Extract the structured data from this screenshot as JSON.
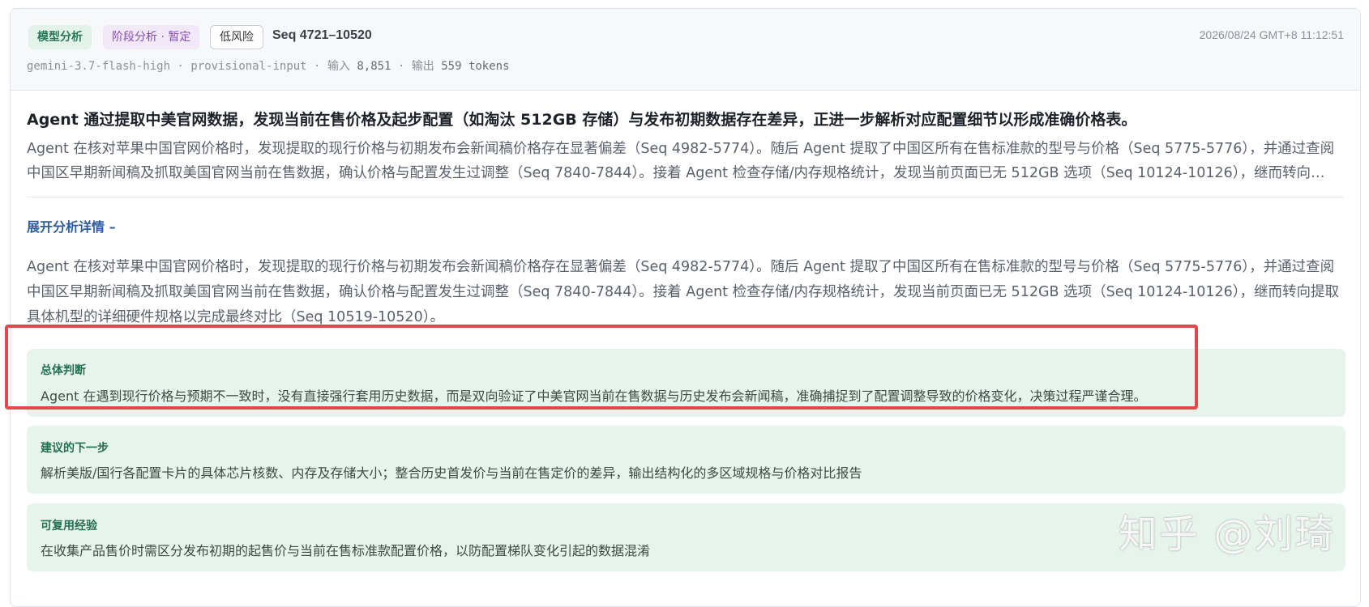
{
  "header": {
    "tags": [
      "模型分析",
      "阶段分析 · 暂定",
      "低风险"
    ],
    "seq": "Seq 4721–10520",
    "timestamp": "2026/08/24 GMT+8 11:12:51",
    "meta": {
      "model": "gemini-3.7-flash-high",
      "mode": "provisional-input",
      "input_label": "输入",
      "input_value": "8,851",
      "output_label": "输出",
      "output_value": "559 tokens"
    }
  },
  "main": {
    "headline": "Agent 通过提取中美官网数据，发现当前在售价格及起步配置（如淘汰 512GB 存储）与发布初期数据存在差异，正进一步解析对应配置细节以形成准确价格表。",
    "summary": "Agent 在核对苹果中国官网价格时，发现提取的现行价格与初期发布会新闻稿价格存在显著偏差（Seq 4982-5774）。随后 Agent 提取了中国区所有在售标准款的型号与价格（Seq 5775-5776），并通过查阅中国区早期新闻稿及抓取美国官网当前在售数据，确认价格与配置发生过调整（Seq 7840-7844）。接着 Agent 检查存储/内存规格统计，发现当前页面已无 512GB 选项（Seq 10124-10126），继而转向…",
    "toggle_label": "展开分析详情 –",
    "detail": "Agent 在核对苹果中国官网价格时，发现提取的现行价格与初期发布会新闻稿价格存在显著偏差（Seq 4982-5774）。随后 Agent 提取了中国区所有在售标准款的型号与价格（Seq 5775-5776），并通过查阅中国区早期新闻稿及抓取美国官网当前在售数据，确认价格与配置发生过调整（Seq 7840-7844）。接着 Agent 检查存储/内存规格统计，发现当前页面已无 512GB 选项（Seq 10124-10126），继而转向提取具体机型的详细硬件规格以完成最终对比（Seq 10519-10520）。"
  },
  "boxes": [
    {
      "title": "总体判断",
      "text": "Agent 在遇到现行价格与预期不一致时，没有直接强行套用历史数据，而是双向验证了中美官网当前在售数据与历史发布会新闻稿，准确捕捉到了配置调整导致的价格变化，决策过程严谨合理。"
    },
    {
      "title": "建议的下一步",
      "text": "解析美版/国行各配置卡片的具体芯片核数、内存及存储大小；整合历史首发价与当前在售定价的差异，输出结构化的多区域规格与价格对比报告"
    },
    {
      "title": "可复用经验",
      "text": "在收集产品售价时需区分发布初期的起售价与当前在售标准款配置价格，以防配置梯队变化引起的数据混淆"
    }
  ],
  "watermark": "知乎 @刘琦",
  "colors": {
    "highlight_border": "#e2474b",
    "box_bg": "#e6f4ec",
    "link": "#2d5ca6"
  }
}
